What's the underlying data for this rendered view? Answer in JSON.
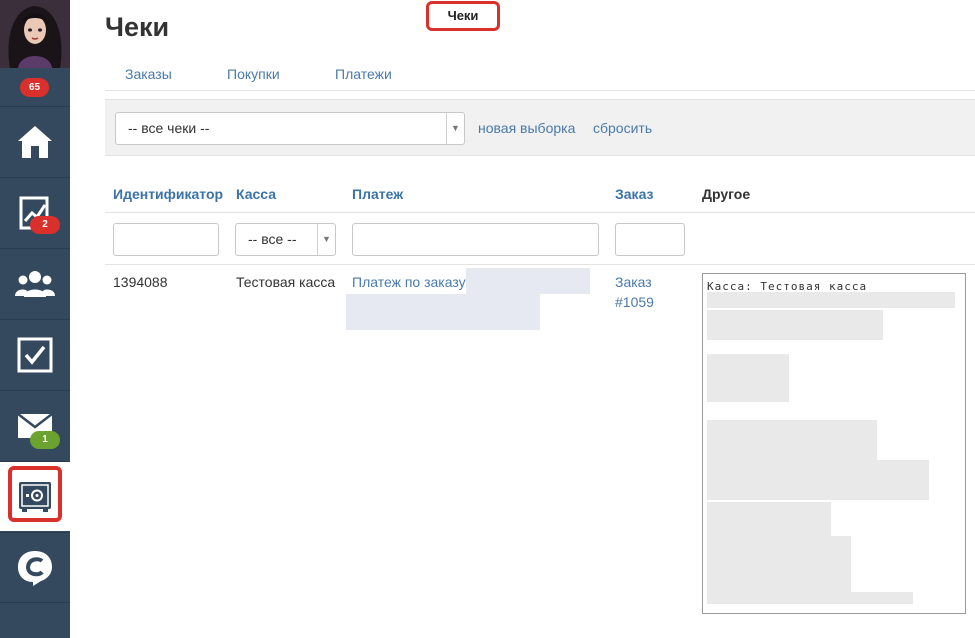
{
  "sidebar": {
    "notification_count": "65",
    "items": [
      {
        "icon": "home-icon"
      },
      {
        "icon": "chart-icon",
        "badge": "2",
        "badge_color": "#d9302c"
      },
      {
        "icon": "users-icon"
      },
      {
        "icon": "tasks-icon"
      },
      {
        "icon": "mail-icon",
        "badge": "1",
        "badge_color": "#6aa42e"
      },
      {
        "icon": "safe-icon",
        "active": true
      },
      {
        "icon": "logo-c-icon"
      }
    ]
  },
  "page": {
    "title": "Чеки"
  },
  "tabs": [
    {
      "label": "Заказы"
    },
    {
      "label": "Покупки"
    },
    {
      "label": "Платежи"
    },
    {
      "label": "Чеки",
      "active": true
    }
  ],
  "filters": {
    "receipt_select": "-- все чеки --",
    "new_selection": "новая выборка",
    "reset": "сбросить"
  },
  "table": {
    "columns": [
      "Идентификатор",
      "Касса",
      "Платеж",
      "Заказ",
      "Другое"
    ],
    "cashbox_filter": "-- все --",
    "rows": [
      {
        "id": "1394088",
        "cashbox": "Тестовая касса",
        "payment": "Платеж по заказу",
        "order_line1": "Заказ",
        "order_line2": "#1059",
        "other_line": "Касса: Тестовая касса"
      }
    ]
  },
  "colors": {
    "accent": "#4a7aaa",
    "highlight": "#d9302c",
    "sidebar": "#34495e"
  }
}
